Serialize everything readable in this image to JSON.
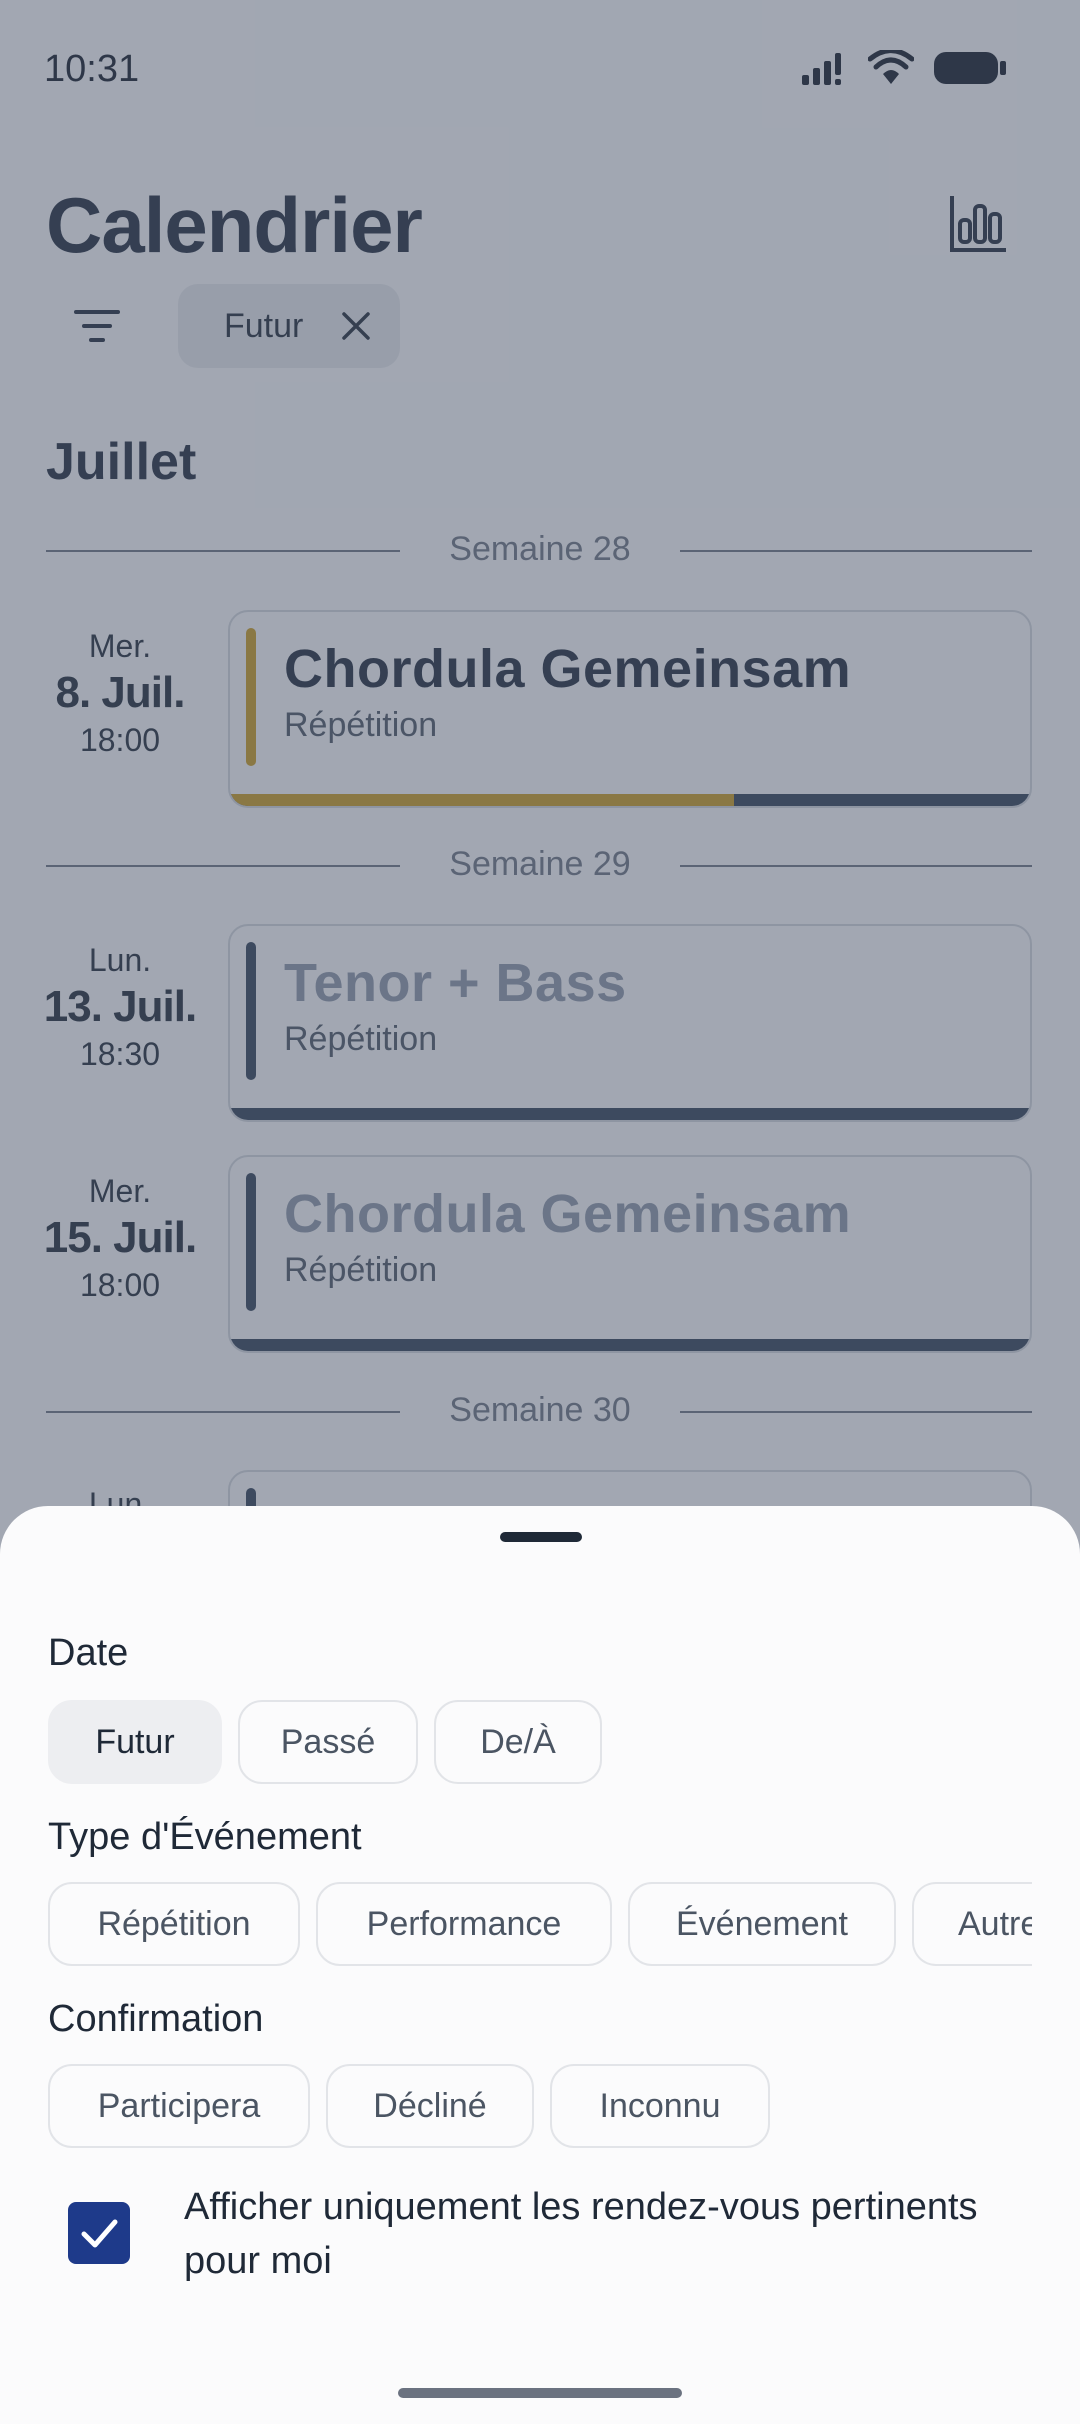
{
  "status_bar": {
    "time": "10:31"
  },
  "header": {
    "title": "Calendrier",
    "active_filter_chip": "Futur"
  },
  "month": "Juillet",
  "weeks": [
    "Semaine 28",
    "Semaine 29",
    "Semaine 30"
  ],
  "events": [
    {
      "day": "Mer.",
      "date": "8. Juil.",
      "time": "18:00",
      "title": "Chordula Gemeinsam",
      "type": "Répétition",
      "stripe_color": "#c99a1e",
      "confirmed_fraction": 0.64
    },
    {
      "day": "Lun.",
      "date": "13. Juil.",
      "time": "18:30",
      "title": "Tenor + Bass",
      "type": "Répétition",
      "stripe_color": "#2f3e55",
      "confirmed_fraction": 0
    },
    {
      "day": "Mer.",
      "date": "15. Juil.",
      "time": "18:00",
      "title": "Chordula Gemeinsam",
      "type": "Répétition",
      "stripe_color": "#2f3e55",
      "confirmed_fraction": 0
    },
    {
      "day": "Lun.",
      "date": "",
      "time": "",
      "title": "",
      "type": ""
    }
  ],
  "filter_sheet": {
    "date": {
      "label": "Date",
      "options": [
        "Futur",
        "Passé",
        "De/À"
      ],
      "selected": "Futur"
    },
    "event_type": {
      "label": "Type d'Événement",
      "options": [
        "Répétition",
        "Performance",
        "Événement",
        "Autre"
      ]
    },
    "confirmation": {
      "label": "Confirmation",
      "options": [
        "Participera",
        "Décliné",
        "Inconnu"
      ]
    },
    "relevant_only": {
      "label": "Afficher uniquement les rendez-vous pertinents pour moi",
      "checked": true
    }
  },
  "colors": {
    "accent_gold": "#c99a1e",
    "navy": "#2f3e55",
    "checkbox_blue": "#1e3a8a"
  }
}
